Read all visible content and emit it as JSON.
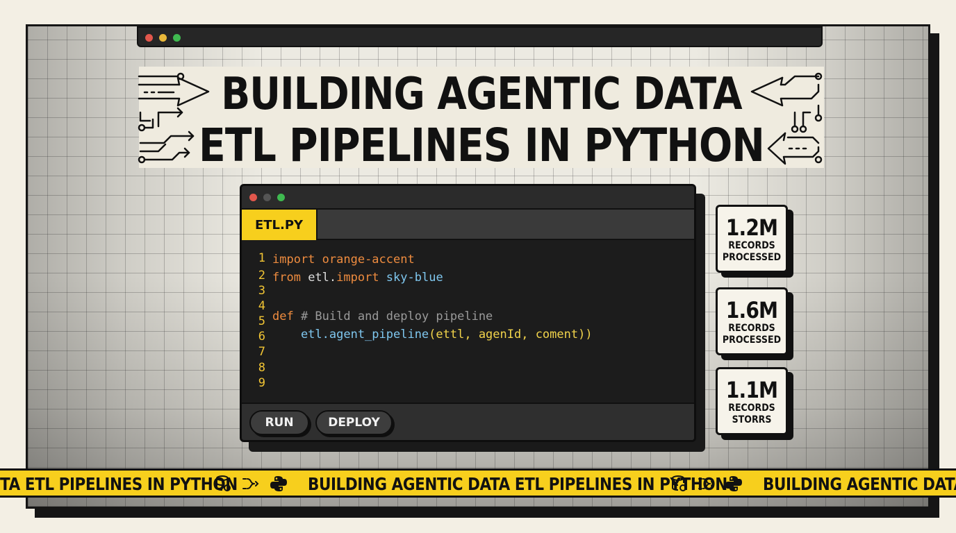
{
  "window": {
    "title_line_1": "BUILDING AGENTIC DATA",
    "title_line_2": "ETL PIPELINES IN PYTHON"
  },
  "colors": {
    "accent_yellow": "#f7cf1d",
    "dot_red": "#e2574c",
    "dot_yellow": "#e9b83a",
    "dot_green": "#3fb950",
    "keyword_orange": "#ef8c3f",
    "sky_blue": "#7fc7ef"
  },
  "editor": {
    "tab_label": "ETL.PY",
    "line_numbers": [
      "1",
      "2",
      "3",
      "4",
      "5",
      "6",
      "7",
      "8",
      "9"
    ],
    "lines": [
      {
        "a": "import",
        "b": " orange-accent"
      },
      {
        "a": "from",
        "b": " etl.",
        "c": "import",
        "d": " sky-blue"
      },
      {},
      {},
      {
        "a": "def",
        "b": " # Build and deploy pipeline"
      },
      {
        "a": "    etl.agent_pipeline",
        "b": "(ettl, agenId, coment))"
      },
      {},
      {},
      {}
    ],
    "run_label": "RUN",
    "deploy_label": "DEPLOY"
  },
  "stats": [
    {
      "value": "1.2M",
      "label_1": "RECORDS",
      "label_2": "PROCESSED"
    },
    {
      "value": "1.6M",
      "label_1": "RECORDS",
      "label_2": "PROCESSED"
    },
    {
      "value": "1.1M",
      "label_1": "RECORDS",
      "label_2": "STORRS"
    }
  ],
  "ticker": {
    "segment_a": "TA ETL PIPELINES IN PYTHON",
    "segment_b": "BUILDING AGENTIC DATA ETL PIPELINES IN PYTHON",
    "segment_c": "BUILDING AGENTIC DATA ETL",
    "icons": [
      "database-icon",
      "pipeline-icon",
      "python-icon"
    ]
  }
}
